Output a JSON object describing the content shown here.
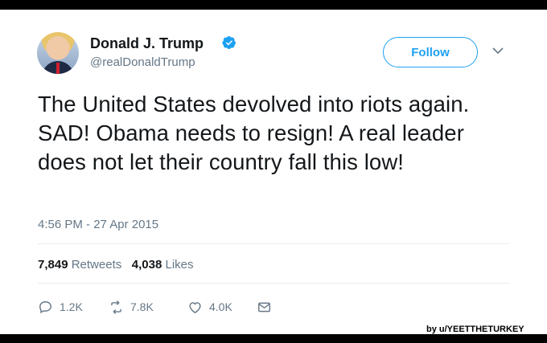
{
  "user": {
    "name": "Donald J. Trump",
    "handle": "@realDonaldTrump",
    "verified": true
  },
  "follow_label": "Follow",
  "tweet": {
    "text": "The United States devolved into riots again. SAD! Obama needs to resign! A real leader does not let their country fall this low!",
    "timestamp": "4:56 PM - 27 Apr 2015"
  },
  "stats": {
    "retweets_count": "7,849",
    "retweets_label": "Retweets",
    "likes_count": "4,038",
    "likes_label": "Likes"
  },
  "actions": {
    "reply_count": "1.2K",
    "retweet_count": "7.8K",
    "like_count": "4.0K"
  },
  "credit": "by u/YEETTHETURKEY",
  "colors": {
    "accent": "#1da1f2",
    "muted": "#657786",
    "text": "#14171a"
  }
}
